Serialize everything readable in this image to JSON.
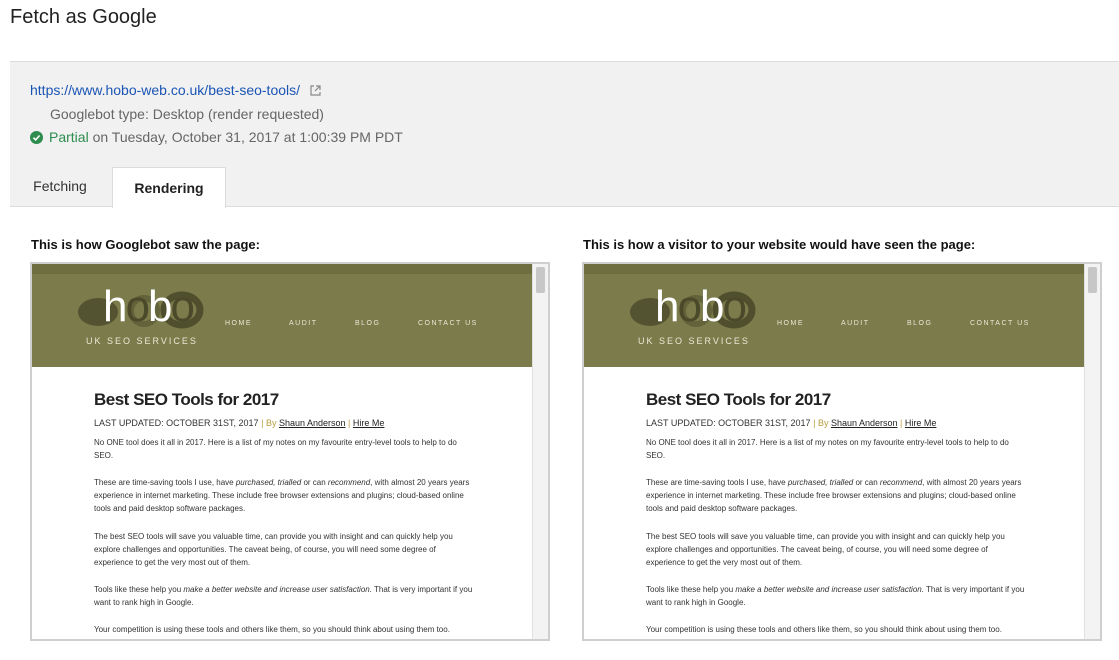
{
  "page_title": "Fetch as Google",
  "summary": {
    "url": "https://www.hobo-web.co.uk/best-seo-tools/",
    "googlebot_type": "Googlebot type: Desktop (render requested)",
    "status_word": "Partial",
    "status_date": " on Tuesday, October 31, 2017 at 1:00:39 PM PDT"
  },
  "tabs": [
    {
      "label": "Fetching",
      "active": false
    },
    {
      "label": "Rendering",
      "active": true
    }
  ],
  "panels": {
    "left_caption": "This is how Googlebot saw the page:",
    "right_caption": "This is how a visitor to your website would have seen the page:"
  },
  "site": {
    "logo_text_h": "h",
    "logo_text_o1": "o",
    "logo_text_b": "b",
    "logo_text_o2": "o",
    "tagline": "UK SEO SERVICES",
    "nav": [
      "HOME",
      "AUDIT",
      "BLOG",
      "CONTACT US"
    ],
    "header_color": "#7b7b4b"
  },
  "article": {
    "title": "Best SEO Tools for 2017",
    "last_updated": "LAST UPDATED: OCTOBER 31ST, 2017",
    "by": "By",
    "author": "Shaun Anderson",
    "hire": "Hire Me",
    "p1": "No ONE tool does it all in 2017. Here is a list of my notes on my favourite entry-level tools to help to do SEO.",
    "p2_a": "These are time-saving tools I use, have ",
    "p2_em1": "purchased, trialled",
    "p2_b": " or can ",
    "p2_em2": "recommend",
    "p2_c": ", with almost 20 years years experience in internet marketing. These include free browser extensions and plugins; cloud-based online tools and paid desktop software packages.",
    "p3": "The best SEO tools will save you valuable time, can provide you with insight and can quickly help you explore challenges and opportunities. The caveat being, of course, you will need some degree of experience to get the very most out of them.",
    "p4_a": "Tools like these help you ",
    "p4_em": "make a better website and increase user satisfaction.",
    "p4_b": " That is very important if you want to rank high in Google.",
    "p5": "Your competition is using these tools and others like them, so you should think about using them too."
  },
  "colors": {
    "link": "#1a55b5",
    "success": "#2d8c4e"
  }
}
